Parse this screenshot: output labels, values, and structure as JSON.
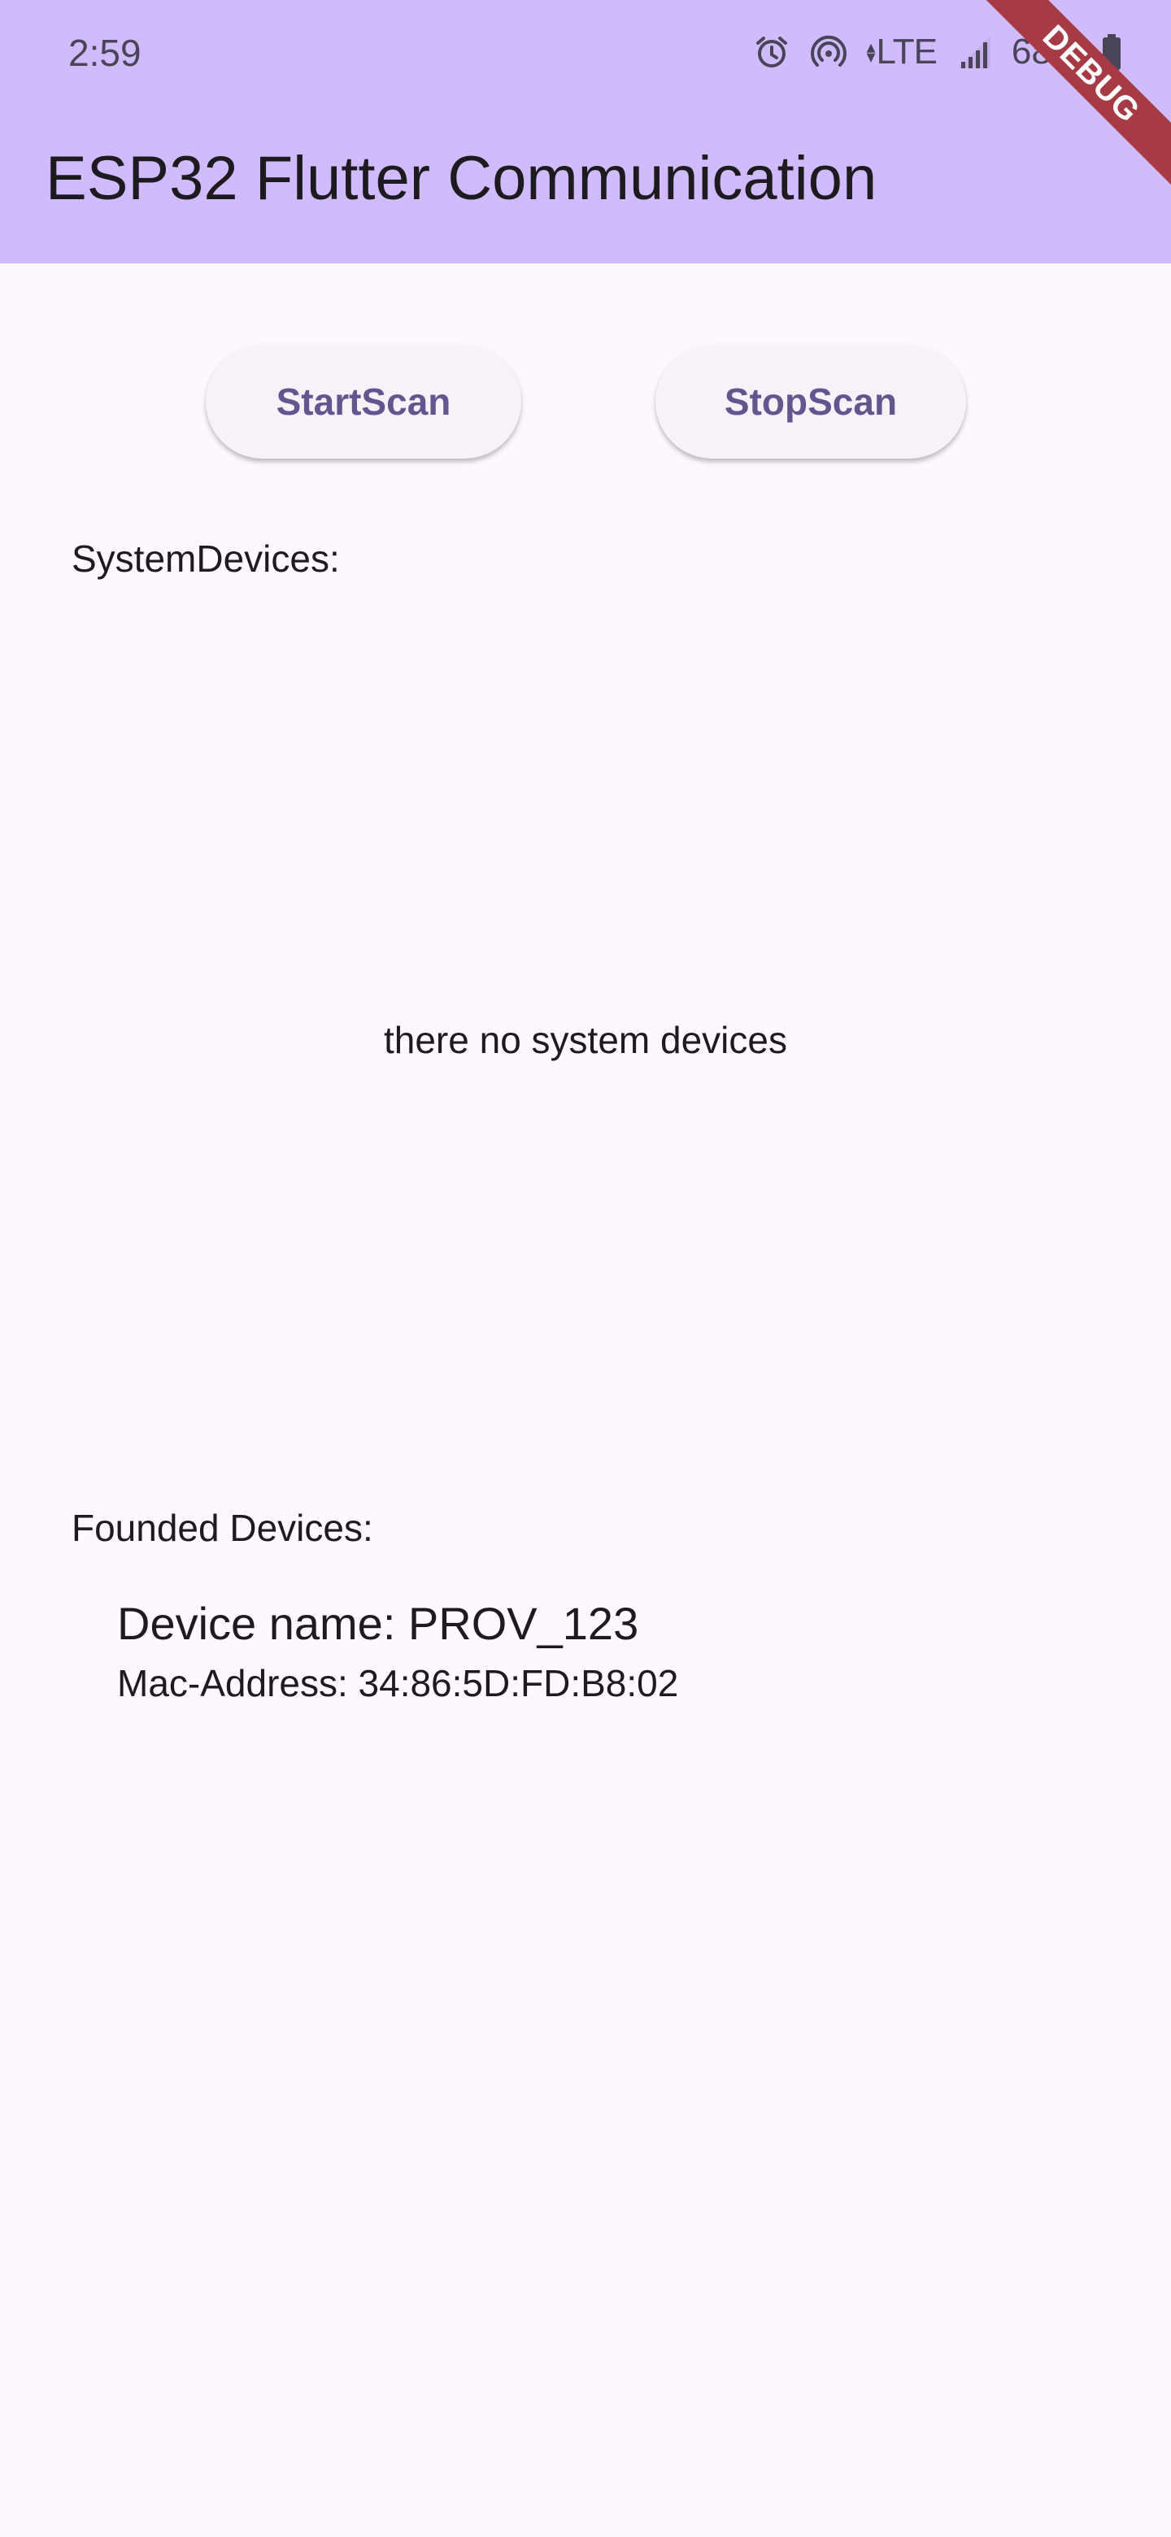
{
  "status_bar": {
    "time": "2:59",
    "network": "LTE",
    "battery": "68%",
    "icons": [
      "alarm-icon",
      "hotspot-icon",
      "lte-icon",
      "signal-icon",
      "battery-icon"
    ]
  },
  "appbar": {
    "title": "ESP32 Flutter Communication",
    "color": "#d0bcfc"
  },
  "debug_banner": "DEBUG",
  "actions": {
    "start_label": "StartScan",
    "stop_label": "StopScan"
  },
  "system_devices": {
    "label": "SystemDevices:",
    "empty_message": "there no system devices"
  },
  "found_devices": {
    "label": "Founded Devices:",
    "items": [
      {
        "name": "Device name: PROV_123",
        "mac": "Mac-Address: 34:86:5D:FD:B8:02"
      }
    ]
  },
  "colors": {
    "background": "#fdf7fe",
    "button_text": "#65558f",
    "debug_banner": "#a63a45"
  }
}
